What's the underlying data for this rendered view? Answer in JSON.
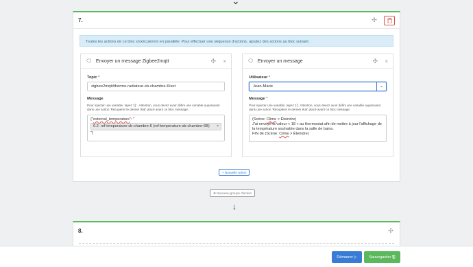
{
  "block7": {
    "number": "7.",
    "info": "Toutes les actions de ce bloc s'exécuteront en parallèle. Pour effectuer une séquence d'actions, ajoutez des actions au bloc suivant.",
    "left_panel": {
      "title": "Envoyer un message Zigbee2mqtt",
      "topic_label": "Topic",
      "topic_value": "zigbee2mqtt/thermo-radiateur-sb-chambre-6/set",
      "message_label": "Message",
      "help": "Pour injecter une variable, tapez '{{' . Attention, vous devez avoir défini une variable auparavant dans une action 'Récupérer le dernier état' placé avant ce bloc message.",
      "message_line1_prefix": "{\"",
      "message_line1_word": "external_temperature",
      "message_line1_suffix": "\": \"",
      "token": "6.2. ref-temperature-sb-chambre-6 (ref-temperature-sb-chambre-6B)",
      "message_end": "\"}"
    },
    "right_panel": {
      "title": "Envoyer un message",
      "user_label": "Utilisateur",
      "user_value": "Jean-Marie",
      "message_label": "Message",
      "help": "Pour injecter une variable, tapez '{{'. Attention, vous devez avoir défini une variable auparavant dans une action 'Récupérer le dernier état' placé avant ce bloc message.",
      "line1_a": "(Scène: ",
      "line1_word": "Clime",
      "line1_b": " > Éteindre)",
      "line2": "J'ai envoyé la valeur « 18 » au thermostat afin de mettre à jour l'affichage de la température souhaitée dans la salle de bains.",
      "line3_a": "FIN de (Scène: ",
      "line3_word": "Clime",
      "line3_b": " > Éteindre)"
    },
    "new_action": "+ Nouvelle action"
  },
  "new_group": "⊕ Nouveau groupe d'action",
  "block8": {
    "number": "8."
  },
  "footer": {
    "start": "Démarrer ▷",
    "save": "Sauvegarder 🖫"
  },
  "colors": {
    "primary": "#3a7bd5",
    "success": "#5cb85c",
    "danger": "#d9534f",
    "info_bg": "#d9ecf7"
  }
}
